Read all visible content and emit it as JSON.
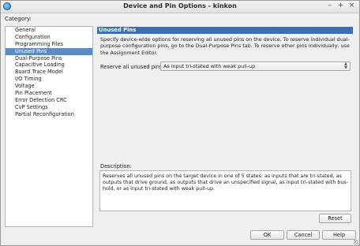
{
  "window": {
    "title": "Device and Pin Options - kinkon",
    "controls": {
      "minimize": "–",
      "maximize": "+",
      "close": "×"
    },
    "app_icon": "globe-icon"
  },
  "category": {
    "label": "Category:",
    "items": [
      "General",
      "Configuration",
      "Programming Files",
      "Unused Pins",
      "Dual-Purpose Pins",
      "Capacitive Loading",
      "Board Trace Model",
      "I/O Timing",
      "Voltage",
      "Pin Placement",
      "Error Detection CRC",
      "CvP Settings",
      "Partial Reconfiguration"
    ],
    "selected": "Unused Pins"
  },
  "panel": {
    "heading": "Unused Pins",
    "intro": "Specify device-wide options for reserving all unused pins on the device. To reserve individual dual-purpose configuration pins, go to the Dual-Purpose Pins tab. To reserve other pins individually, use the Assignment Editor.",
    "reserve_label": "Reserve all unused pins:",
    "reserve_value": "As input tri-stated with weak pull-up",
    "description_label": "Description:",
    "description": "Reserves all unused pins on the target device in one of 5 states: as inputs that are tri-stated, as outputs that drive ground, as outputs that drive an unspecified signal, as input tri-stated with bus-hold, or as input tri-stated with weak pull-up.",
    "reset_label": "Reset"
  },
  "footer": {
    "ok_label": "OK",
    "cancel_label": "Cancel",
    "help_label": "Help"
  },
  "colors": {
    "selection": "#5d8bc9",
    "panel_header": "#3d6fb4",
    "background": "#efefee"
  }
}
